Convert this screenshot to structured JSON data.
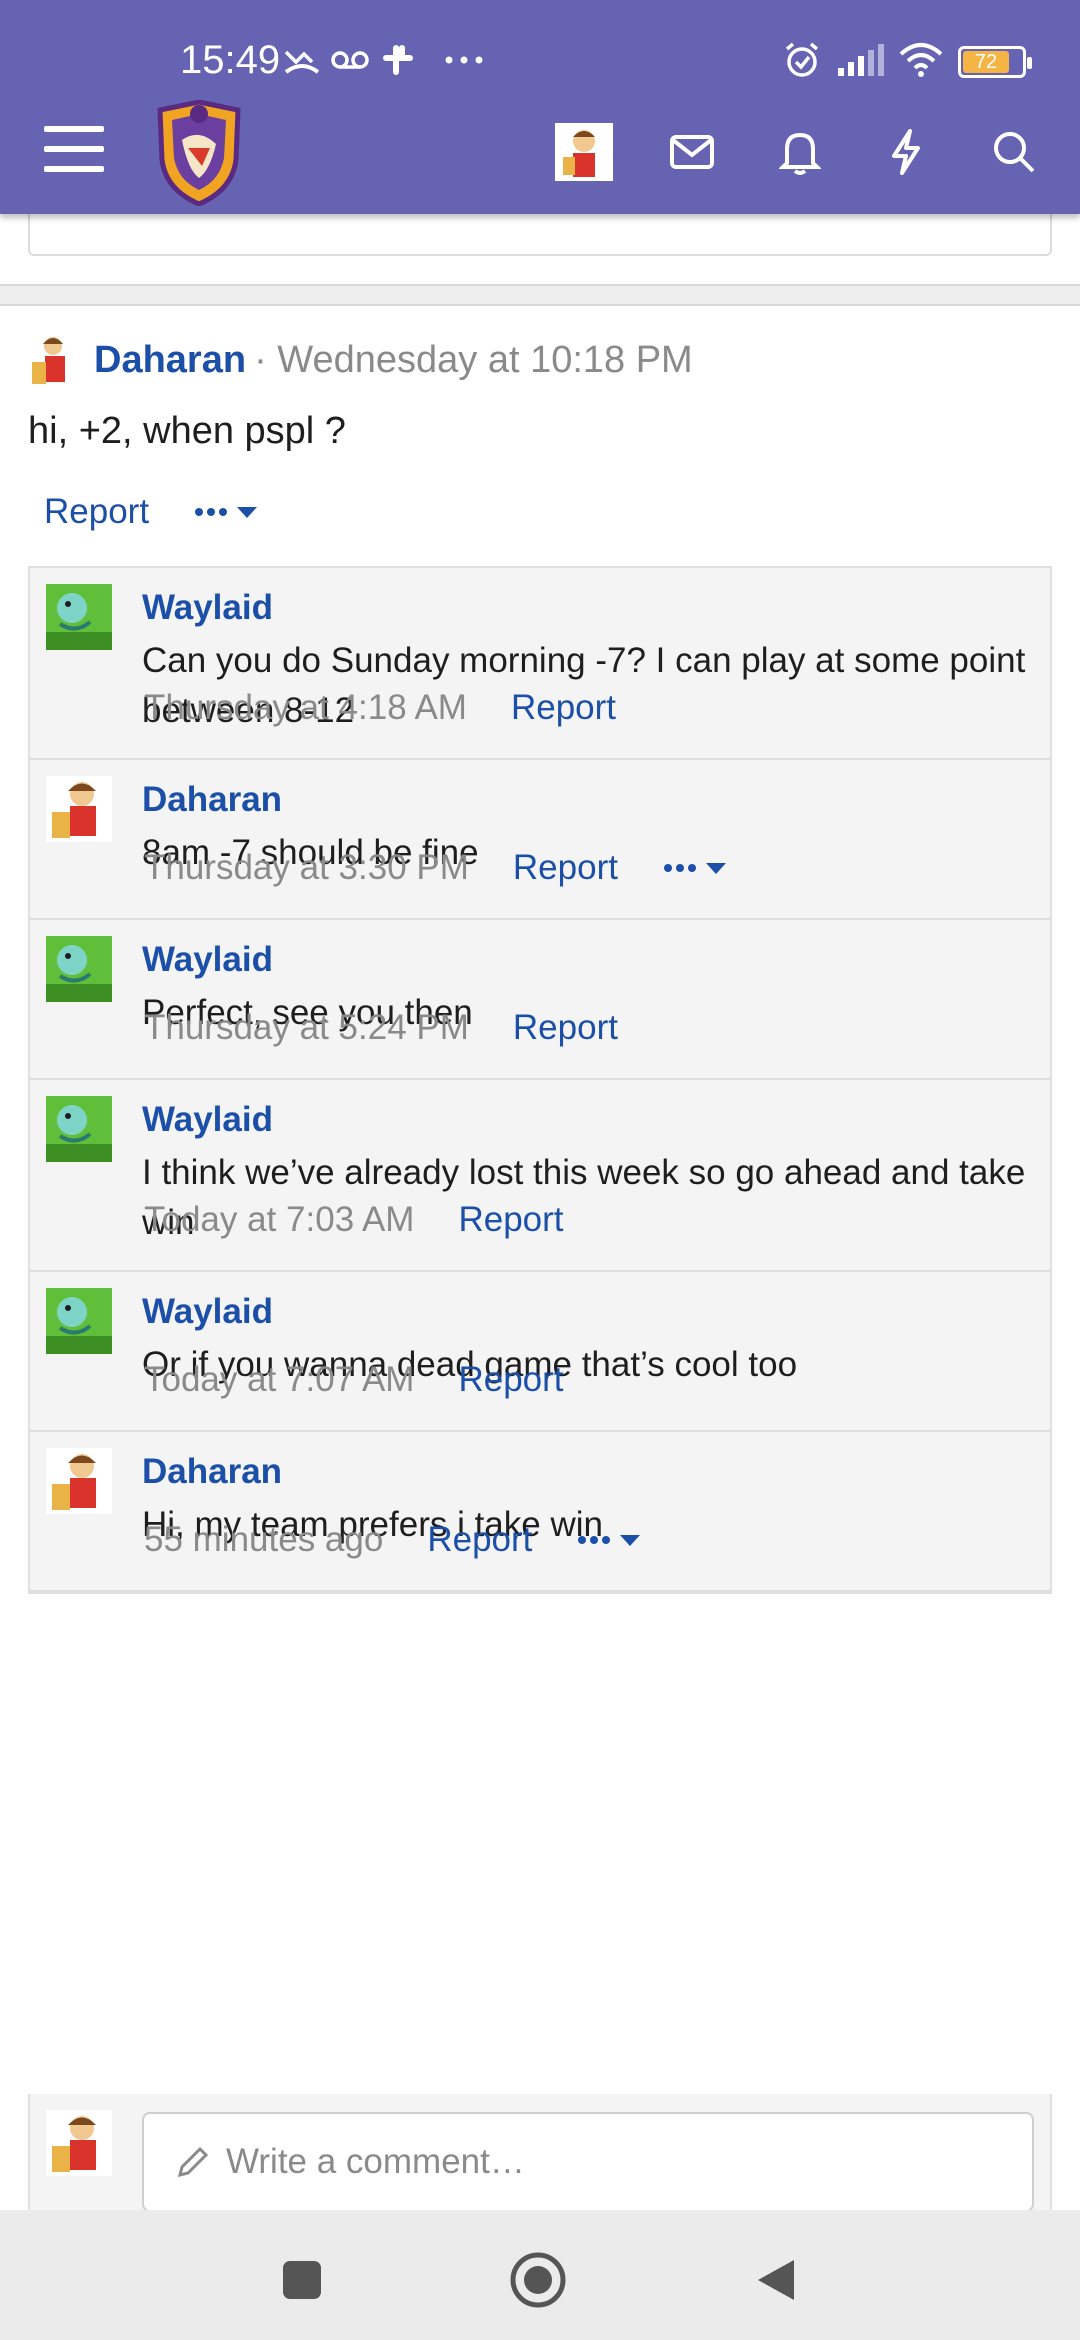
{
  "status_bar": {
    "time": "15:49",
    "battery_level": "72"
  },
  "header": {
    "icons": [
      "menu-icon",
      "site-logo",
      "user-avatar",
      "mail-icon",
      "bell-icon",
      "lightning-icon",
      "search-icon"
    ]
  },
  "post": {
    "author": "Daharan",
    "meta": "· Wednesday at 10:18 PM",
    "body": "hi, +2, when pspl ?",
    "report_label": "Report"
  },
  "comments": [
    {
      "author": "Waylaid",
      "text": "Can you do Sunday morning -7? I can play at some point between 8-12",
      "time": "Thursday at 4:18 AM",
      "report": "Report",
      "has_more": false,
      "avatar": "waylaid"
    },
    {
      "author": "Daharan",
      "text": "8am -7 should be fine",
      "time": "Thursday at 3:30 PM",
      "report": "Report",
      "has_more": true,
      "avatar": "daharan"
    },
    {
      "author": "Waylaid",
      "text": "Perfect, see you then",
      "time": "Thursday at 5:24 PM",
      "report": "Report",
      "has_more": false,
      "avatar": "waylaid"
    },
    {
      "author": "Waylaid",
      "text": "I think we’ve already lost this week so go ahead and take win",
      "time": "Today at 7:03 AM",
      "report": "Report",
      "has_more": false,
      "avatar": "waylaid"
    },
    {
      "author": "Waylaid",
      "text": "Or if you wanna dead game that’s cool too",
      "time": "Today at 7:07 AM",
      "report": "Report",
      "has_more": false,
      "avatar": "waylaid"
    },
    {
      "author": "Daharan",
      "text": "Hi, my team prefers i take win",
      "time": "55 minutes ago",
      "report": "Report",
      "has_more": true,
      "avatar": "daharan"
    }
  ],
  "comment_box": {
    "placeholder": "Write a comment…"
  },
  "colors": {
    "header": "#6563b2",
    "link": "#1b4fa8",
    "muted": "#8a8a8a"
  }
}
